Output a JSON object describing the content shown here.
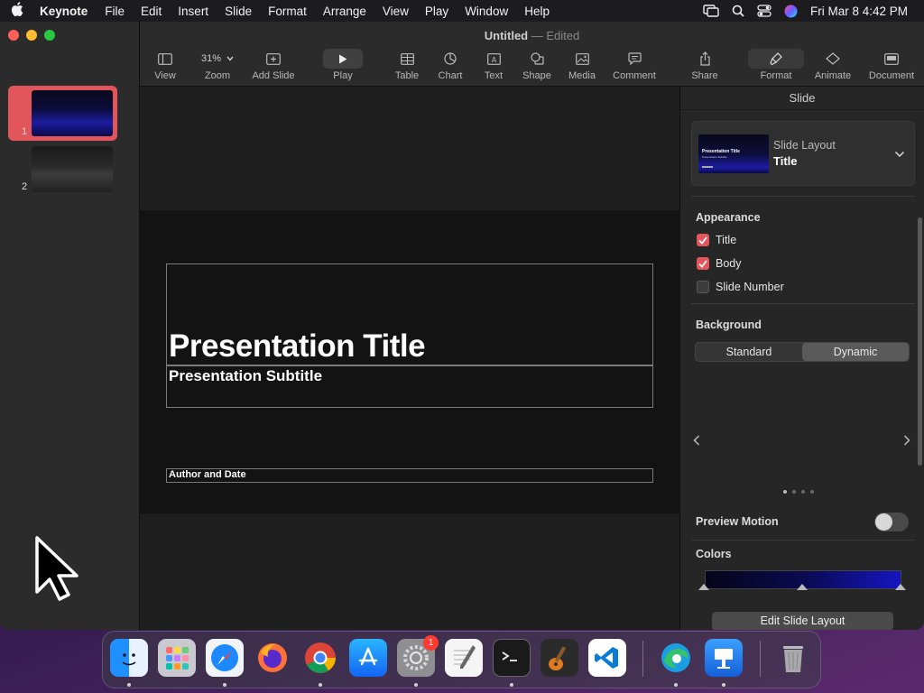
{
  "menubar": {
    "app_name": "Keynote",
    "items": [
      "File",
      "Edit",
      "Insert",
      "Slide",
      "Format",
      "Arrange",
      "View",
      "Play",
      "Window",
      "Help"
    ],
    "clock": "Fri Mar 8  4:42 PM"
  },
  "window": {
    "doc_name": "Untitled",
    "separator": "—",
    "doc_state": "Edited"
  },
  "toolbar": {
    "view": "View",
    "zoom_value": "31%",
    "zoom": "Zoom",
    "add_slide": "Add Slide",
    "play": "Play",
    "table": "Table",
    "chart": "Chart",
    "text": "Text",
    "shape": "Shape",
    "media": "Media",
    "comment": "Comment",
    "share": "Share",
    "format": "Format",
    "animate": "Animate",
    "document": "Document"
  },
  "navigator": {
    "slides": [
      {
        "number": "1",
        "selected": true
      },
      {
        "number": "2",
        "selected": false
      }
    ]
  },
  "slide": {
    "title": "Presentation Title",
    "subtitle": "Presentation Subtitle",
    "author": "Author and Date"
  },
  "inspector": {
    "header": "Slide",
    "layout_label": "Slide Layout",
    "layout_value": "Title",
    "layout_thumb_title": "Presentation Title",
    "layout_thumb_sub": "Presentation Subtitle",
    "appearance_heading": "Appearance",
    "checkboxes": [
      {
        "label": "Title",
        "checked": true
      },
      {
        "label": "Body",
        "checked": true
      },
      {
        "label": "Slide Number",
        "checked": false
      }
    ],
    "background_heading": "Background",
    "background_options": [
      "Standard",
      "Dynamic"
    ],
    "background_selected": "Dynamic",
    "preview_motion": "Preview Motion",
    "preview_motion_on": false,
    "colors_heading": "Colors",
    "edit_layout_button": "Edit Slide Layout",
    "gradient_colors": [
      "#05051a",
      "#0a0a50",
      "#1515c0"
    ]
  },
  "dock": {
    "apps": [
      "Finder",
      "Launchpad",
      "Safari",
      "Firefox",
      "Chrome",
      "App Store",
      "System Settings",
      "TextEdit",
      "Terminal",
      "GarageBand",
      "Visual Studio Code",
      "Edge",
      "Keynote",
      "Trash"
    ],
    "settings_badge": "1"
  },
  "colors": {
    "accent": "#e2555a",
    "window_bg": "#1e1e1e",
    "slide_bg": "#131313"
  }
}
